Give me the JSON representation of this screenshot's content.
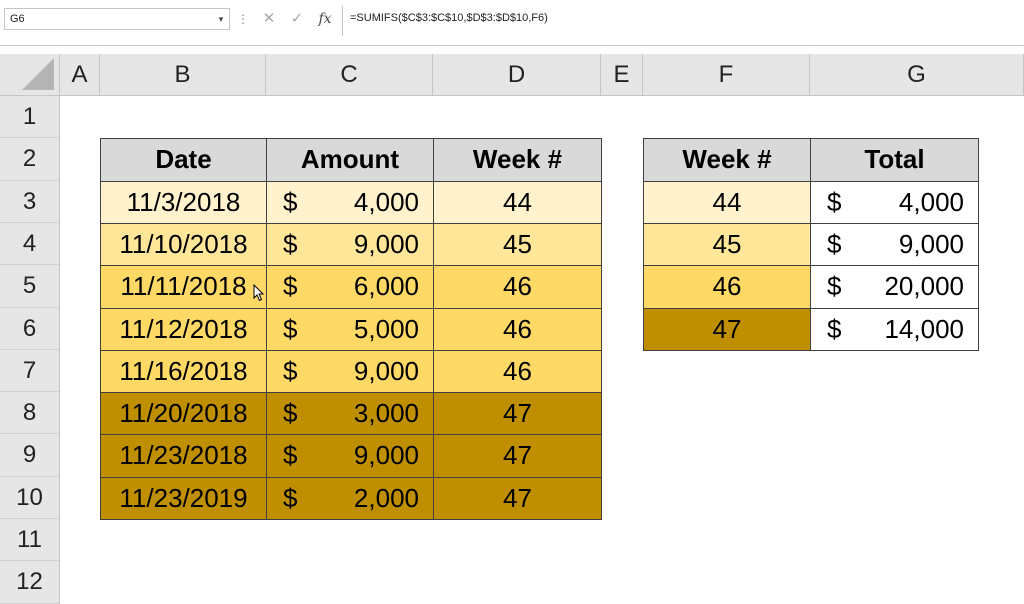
{
  "formula_bar": {
    "name_box": "G6",
    "dropdown_glyph": "▾",
    "grip_glyph": "⋮",
    "cancel_glyph": "✕",
    "enter_glyph": "✓",
    "fx_glyph": "fx",
    "formula": "=SUMIFS($C$3:$C$10,$D$3:$D$10,F6)"
  },
  "columns": [
    "A",
    "B",
    "C",
    "D",
    "E",
    "F",
    "G"
  ],
  "rows": [
    "1",
    "2",
    "3",
    "4",
    "5",
    "6",
    "7",
    "8",
    "9",
    "10",
    "11",
    "12"
  ],
  "colors": {
    "week44": "#fff2cc",
    "week45": "#ffe699",
    "week46": "#ffd966",
    "week47": "#bf8f00",
    "header": "#d9d9d9",
    "total": "#ffffff"
  },
  "table1": {
    "headers": [
      "Date",
      "Amount",
      "Week #"
    ],
    "rows": [
      {
        "date": "11/3/2018",
        "currency": "$",
        "amount": "4,000",
        "week": "44"
      },
      {
        "date": "11/10/2018",
        "currency": "$",
        "amount": "9,000",
        "week": "45"
      },
      {
        "date": "11/11/2018",
        "currency": "$",
        "amount": "6,000",
        "week": "46"
      },
      {
        "date": "11/12/2018",
        "currency": "$",
        "amount": "5,000",
        "week": "46"
      },
      {
        "date": "11/16/2018",
        "currency": "$",
        "amount": "9,000",
        "week": "46"
      },
      {
        "date": "11/20/2018",
        "currency": "$",
        "amount": "3,000",
        "week": "47"
      },
      {
        "date": "11/23/2018",
        "currency": "$",
        "amount": "9,000",
        "week": "47"
      },
      {
        "date": "11/23/2019",
        "currency": "$",
        "amount": "2,000",
        "week": "47"
      }
    ]
  },
  "table2": {
    "headers": [
      "Week #",
      "Total"
    ],
    "rows": [
      {
        "week": "44",
        "currency": "$",
        "total": "4,000"
      },
      {
        "week": "45",
        "currency": "$",
        "total": "9,000"
      },
      {
        "week": "46",
        "currency": "$",
        "total": "20,000"
      },
      {
        "week": "47",
        "currency": "$",
        "total": "14,000"
      }
    ]
  }
}
